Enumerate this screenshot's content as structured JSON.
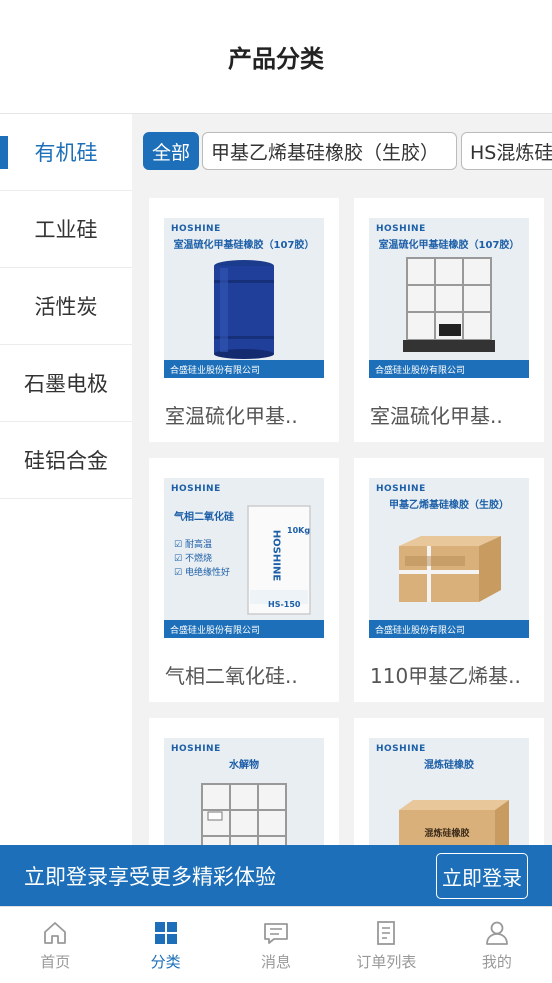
{
  "header": {
    "title": "产品分类"
  },
  "sidebar": {
    "items": [
      {
        "label": "有机硅",
        "active": true
      },
      {
        "label": "工业硅"
      },
      {
        "label": "活性炭"
      },
      {
        "label": "石墨电极"
      },
      {
        "label": "硅铝合金"
      }
    ]
  },
  "tabs": [
    {
      "label": "全部"
    },
    {
      "label": "甲基乙烯基硅橡胶（生胶）"
    },
    {
      "label": "HS混炼硅橡胶"
    }
  ],
  "products": [
    {
      "name": "室温硫化甲基..",
      "brand": "HOSHINE",
      "title": "室温硫化甲基硅橡胶（107胶）",
      "company": "合盛硅业股份有限公司",
      "image": "blue-drum"
    },
    {
      "name": "室温硫化甲基..",
      "brand": "HOSHINE",
      "title": "室温硫化甲基硅橡胶（107胶）",
      "company": "合盛硅业股份有限公司",
      "image": "ibc-tote"
    },
    {
      "name": "气相二氧化硅..",
      "brand": "HOSHINE",
      "title": "气相二氧化硅",
      "company": "合盛硅业股份有限公司",
      "image": "white-bag",
      "bullets": [
        "耐高温",
        "不燃烧",
        "电绝缘性好"
      ],
      "bag_text": "HOSHINE",
      "bag_weight": "10Kg",
      "bag_label": "HS-150"
    },
    {
      "name": "110甲基乙烯基..",
      "brand": "HOSHINE",
      "title": "甲基乙烯基硅橡胶（生胶）",
      "company": "合盛硅业股份有限公司",
      "image": "cardboard-box"
    },
    {
      "name": "",
      "brand": "HOSHINE",
      "title": "水解物",
      "company": "",
      "image": "ibc-tote"
    },
    {
      "name": "",
      "brand": "HOSHINE",
      "title": "混炼硅橡胶",
      "company": "",
      "image": "cardboard-box",
      "box_text": "混炼硅橡胶"
    }
  ],
  "login_bar": {
    "text": "立即登录享受更多精彩体验",
    "button": "立即登录"
  },
  "tabbar": [
    {
      "label": "首页",
      "icon": "home-icon"
    },
    {
      "label": "分类",
      "icon": "grid-icon",
      "active": true
    },
    {
      "label": "消息",
      "icon": "message-icon"
    },
    {
      "label": "订单列表",
      "icon": "order-icon"
    },
    {
      "label": "我的",
      "icon": "user-icon"
    }
  ],
  "colors": {
    "accent": "#1c6fb8"
  }
}
